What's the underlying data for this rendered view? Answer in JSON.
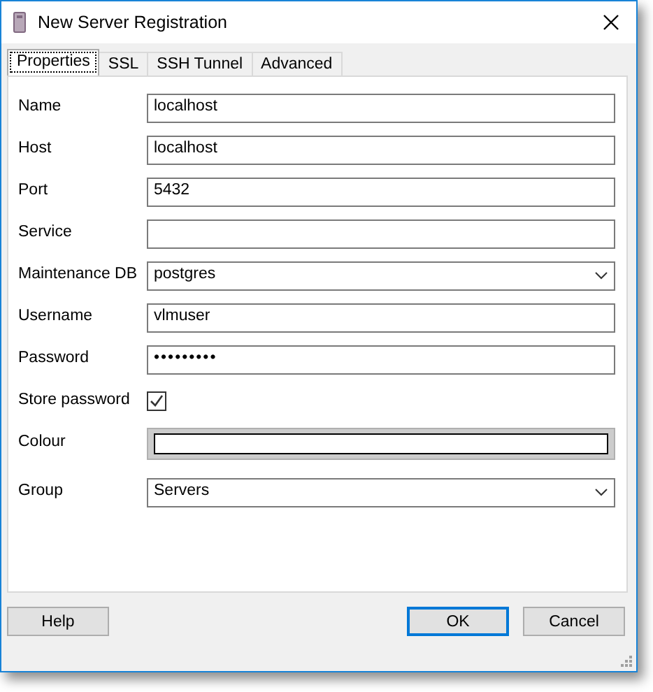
{
  "window": {
    "title": "New Server Registration"
  },
  "tabs": [
    {
      "label": "Properties",
      "selected": true
    },
    {
      "label": "SSL",
      "selected": false
    },
    {
      "label": "SSH Tunnel",
      "selected": false
    },
    {
      "label": "Advanced",
      "selected": false
    }
  ],
  "fields": [
    {
      "label": "Name",
      "kind": "text",
      "value": "localhost"
    },
    {
      "label": "Host",
      "kind": "text",
      "value": "localhost"
    },
    {
      "label": "Port",
      "kind": "text",
      "value": "5432"
    },
    {
      "label": "Service",
      "kind": "text"
    },
    {
      "label": "Maintenance DB",
      "kind": "select",
      "value": "postgres"
    },
    {
      "label": "Username",
      "kind": "text",
      "value": "vlmuser"
    },
    {
      "label": "Password",
      "kind": "password",
      "value": "•••••••••"
    },
    {
      "label": "Store password",
      "kind": "checkbox",
      "checked": true
    },
    {
      "label": "Colour",
      "kind": "colour"
    },
    {
      "label": "Group",
      "kind": "select",
      "value": "Servers"
    }
  ],
  "buttons": [
    {
      "label": "Help",
      "kind": "help"
    },
    {
      "label": "OK",
      "kind": "default"
    },
    {
      "label": "Cancel",
      "kind": "normal"
    }
  ]
}
